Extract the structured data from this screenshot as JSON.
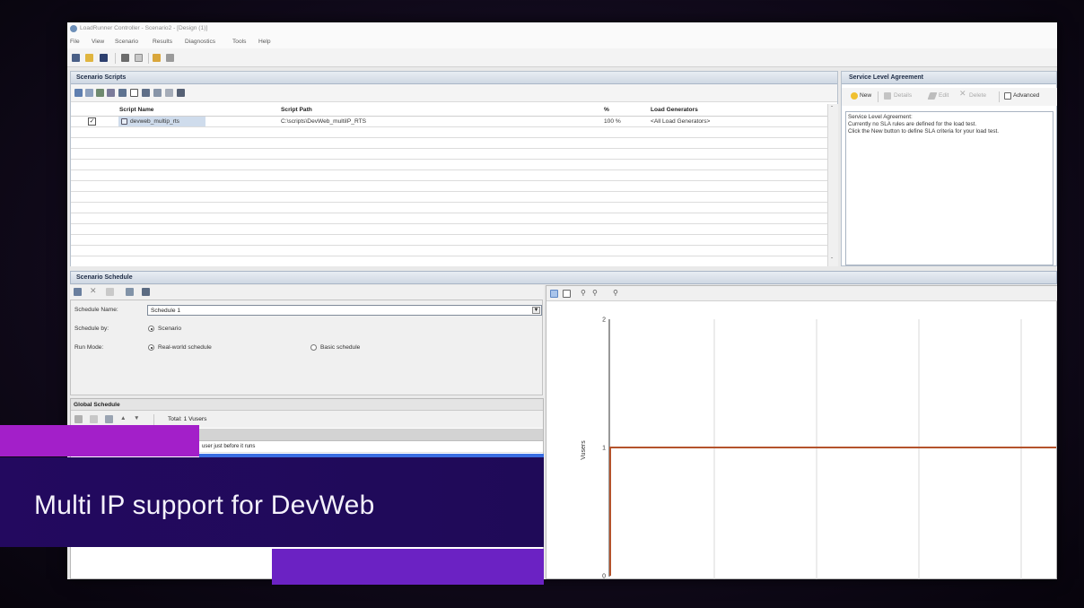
{
  "window": {
    "title": "LoadRunner Controller - Scenario2 - [Design (1)]",
    "menu": [
      "File",
      "View",
      "Scenario",
      "Results",
      "Diagnostics",
      "Tools",
      "Help"
    ]
  },
  "scripts": {
    "title": "Scenario Scripts",
    "columns": [
      "Script Name",
      "Script Path",
      "%",
      "Load Generators"
    ],
    "rows": [
      {
        "checked": true,
        "name": "devweb_multip_rts",
        "path": "C:\\scripts\\DevWeb_multiIP_RTS",
        "percent": "100 %",
        "generators": "<All Load Generators>"
      }
    ]
  },
  "sla": {
    "title": "Service Level Agreement",
    "toolbar": {
      "new": "New",
      "details": "Details",
      "edit": "Edit",
      "delete": "Delete",
      "advanced": "Advanced"
    },
    "lines": [
      "Service Level Agreement:",
      "Currently no SLA rules are defined for the load test.",
      "Click the New button to define SLA criteria for your load test."
    ]
  },
  "schedule": {
    "title": "Scenario Schedule",
    "name_label": "Schedule Name:",
    "name_value": "Schedule 1",
    "by_label": "Schedule by:",
    "by_value": "Scenario",
    "mode_label": "Run Mode:",
    "mode_real": "Real-world schedule",
    "mode_basic": "Basic schedule",
    "mode_selected_index": 0,
    "global": {
      "title": "Global Schedule",
      "total": "Total: 1 Vusers",
      "row": "user just before it runs"
    }
  },
  "chart_data": {
    "type": "line",
    "ylabel": "Vusers",
    "yticks": [
      "2",
      "1",
      "0"
    ],
    "ylim": [
      0,
      2
    ],
    "series": [
      {
        "y": [
          0,
          1,
          1
        ]
      }
    ]
  },
  "overlay": {
    "title": "Multi IP support for DevWeb"
  },
  "colors": {
    "overlay_magenta": "#a31fc9",
    "overlay_indigo": "#23095f",
    "overlay_purple": "#6b22c3",
    "selection_blue": "#3a6ee2",
    "series_line": "#b4532c"
  }
}
